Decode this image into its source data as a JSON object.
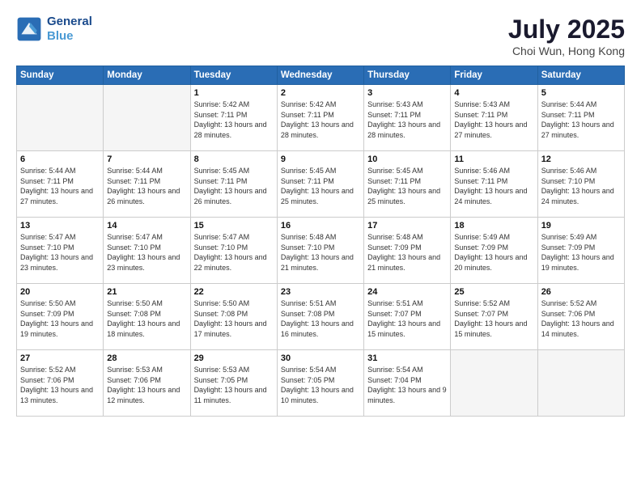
{
  "header": {
    "logo_line1": "General",
    "logo_line2": "Blue",
    "month": "July 2025",
    "location": "Choi Wun, Hong Kong"
  },
  "days_of_week": [
    "Sunday",
    "Monday",
    "Tuesday",
    "Wednesday",
    "Thursday",
    "Friday",
    "Saturday"
  ],
  "weeks": [
    [
      {
        "day": "",
        "info": ""
      },
      {
        "day": "",
        "info": ""
      },
      {
        "day": "1",
        "info": "Sunrise: 5:42 AM\nSunset: 7:11 PM\nDaylight: 13 hours and 28 minutes."
      },
      {
        "day": "2",
        "info": "Sunrise: 5:42 AM\nSunset: 7:11 PM\nDaylight: 13 hours and 28 minutes."
      },
      {
        "day": "3",
        "info": "Sunrise: 5:43 AM\nSunset: 7:11 PM\nDaylight: 13 hours and 28 minutes."
      },
      {
        "day": "4",
        "info": "Sunrise: 5:43 AM\nSunset: 7:11 PM\nDaylight: 13 hours and 27 minutes."
      },
      {
        "day": "5",
        "info": "Sunrise: 5:44 AM\nSunset: 7:11 PM\nDaylight: 13 hours and 27 minutes."
      }
    ],
    [
      {
        "day": "6",
        "info": "Sunrise: 5:44 AM\nSunset: 7:11 PM\nDaylight: 13 hours and 27 minutes."
      },
      {
        "day": "7",
        "info": "Sunrise: 5:44 AM\nSunset: 7:11 PM\nDaylight: 13 hours and 26 minutes."
      },
      {
        "day": "8",
        "info": "Sunrise: 5:45 AM\nSunset: 7:11 PM\nDaylight: 13 hours and 26 minutes."
      },
      {
        "day": "9",
        "info": "Sunrise: 5:45 AM\nSunset: 7:11 PM\nDaylight: 13 hours and 25 minutes."
      },
      {
        "day": "10",
        "info": "Sunrise: 5:45 AM\nSunset: 7:11 PM\nDaylight: 13 hours and 25 minutes."
      },
      {
        "day": "11",
        "info": "Sunrise: 5:46 AM\nSunset: 7:11 PM\nDaylight: 13 hours and 24 minutes."
      },
      {
        "day": "12",
        "info": "Sunrise: 5:46 AM\nSunset: 7:10 PM\nDaylight: 13 hours and 24 minutes."
      }
    ],
    [
      {
        "day": "13",
        "info": "Sunrise: 5:47 AM\nSunset: 7:10 PM\nDaylight: 13 hours and 23 minutes."
      },
      {
        "day": "14",
        "info": "Sunrise: 5:47 AM\nSunset: 7:10 PM\nDaylight: 13 hours and 23 minutes."
      },
      {
        "day": "15",
        "info": "Sunrise: 5:47 AM\nSunset: 7:10 PM\nDaylight: 13 hours and 22 minutes."
      },
      {
        "day": "16",
        "info": "Sunrise: 5:48 AM\nSunset: 7:10 PM\nDaylight: 13 hours and 21 minutes."
      },
      {
        "day": "17",
        "info": "Sunrise: 5:48 AM\nSunset: 7:09 PM\nDaylight: 13 hours and 21 minutes."
      },
      {
        "day": "18",
        "info": "Sunrise: 5:49 AM\nSunset: 7:09 PM\nDaylight: 13 hours and 20 minutes."
      },
      {
        "day": "19",
        "info": "Sunrise: 5:49 AM\nSunset: 7:09 PM\nDaylight: 13 hours and 19 minutes."
      }
    ],
    [
      {
        "day": "20",
        "info": "Sunrise: 5:50 AM\nSunset: 7:09 PM\nDaylight: 13 hours and 19 minutes."
      },
      {
        "day": "21",
        "info": "Sunrise: 5:50 AM\nSunset: 7:08 PM\nDaylight: 13 hours and 18 minutes."
      },
      {
        "day": "22",
        "info": "Sunrise: 5:50 AM\nSunset: 7:08 PM\nDaylight: 13 hours and 17 minutes."
      },
      {
        "day": "23",
        "info": "Sunrise: 5:51 AM\nSunset: 7:08 PM\nDaylight: 13 hours and 16 minutes."
      },
      {
        "day": "24",
        "info": "Sunrise: 5:51 AM\nSunset: 7:07 PM\nDaylight: 13 hours and 15 minutes."
      },
      {
        "day": "25",
        "info": "Sunrise: 5:52 AM\nSunset: 7:07 PM\nDaylight: 13 hours and 15 minutes."
      },
      {
        "day": "26",
        "info": "Sunrise: 5:52 AM\nSunset: 7:06 PM\nDaylight: 13 hours and 14 minutes."
      }
    ],
    [
      {
        "day": "27",
        "info": "Sunrise: 5:52 AM\nSunset: 7:06 PM\nDaylight: 13 hours and 13 minutes."
      },
      {
        "day": "28",
        "info": "Sunrise: 5:53 AM\nSunset: 7:06 PM\nDaylight: 13 hours and 12 minutes."
      },
      {
        "day": "29",
        "info": "Sunrise: 5:53 AM\nSunset: 7:05 PM\nDaylight: 13 hours and 11 minutes."
      },
      {
        "day": "30",
        "info": "Sunrise: 5:54 AM\nSunset: 7:05 PM\nDaylight: 13 hours and 10 minutes."
      },
      {
        "day": "31",
        "info": "Sunrise: 5:54 AM\nSunset: 7:04 PM\nDaylight: 13 hours and 9 minutes."
      },
      {
        "day": "",
        "info": ""
      },
      {
        "day": "",
        "info": ""
      }
    ]
  ]
}
